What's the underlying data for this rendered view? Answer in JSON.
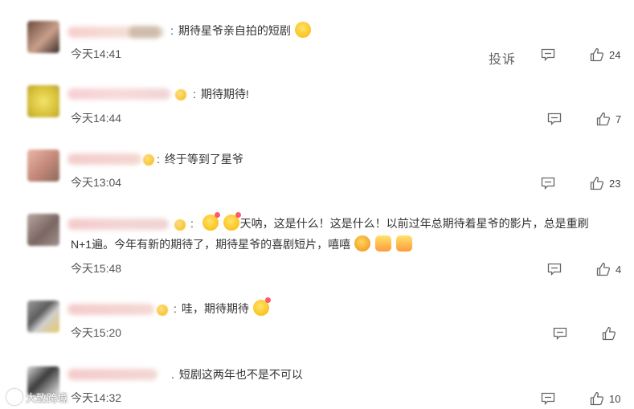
{
  "report_label": "投诉",
  "comments": [
    {
      "text": "期待星爷亲自拍的短剧",
      "time": "今天14:41",
      "likes": "24",
      "emoji": [
        "laugh-emoji"
      ]
    },
    {
      "text": "期待期待!",
      "time": "今天14:44",
      "likes": "7",
      "emoji": []
    },
    {
      "text": "终于等到了星爷",
      "time": "今天13:04",
      "likes": "23",
      "emoji": []
    },
    {
      "text_line1": "天呐，这是什么！这是什么！以前过年总期待着星爷的影片，总是重刷",
      "text_line2": "N+1遍。今年有新的期待了，期待星爷的喜剧短片，嘻嘻",
      "time": "今天15:48",
      "likes": "4",
      "emoji": [
        "heart-eyes-emoji",
        "heart-eyes-emoji",
        "laugh-cry-emoji",
        "cheer-emoji",
        "cheer-emoji"
      ]
    },
    {
      "text": "哇，期待期待",
      "time": "今天15:20",
      "likes": "",
      "emoji": [
        "heart-eyes-emoji"
      ]
    },
    {
      "text": "短剧这两年也不是不可以",
      "time": "今天14:32",
      "likes": "10",
      "emoji": []
    }
  ],
  "watermark": "大致跨境"
}
